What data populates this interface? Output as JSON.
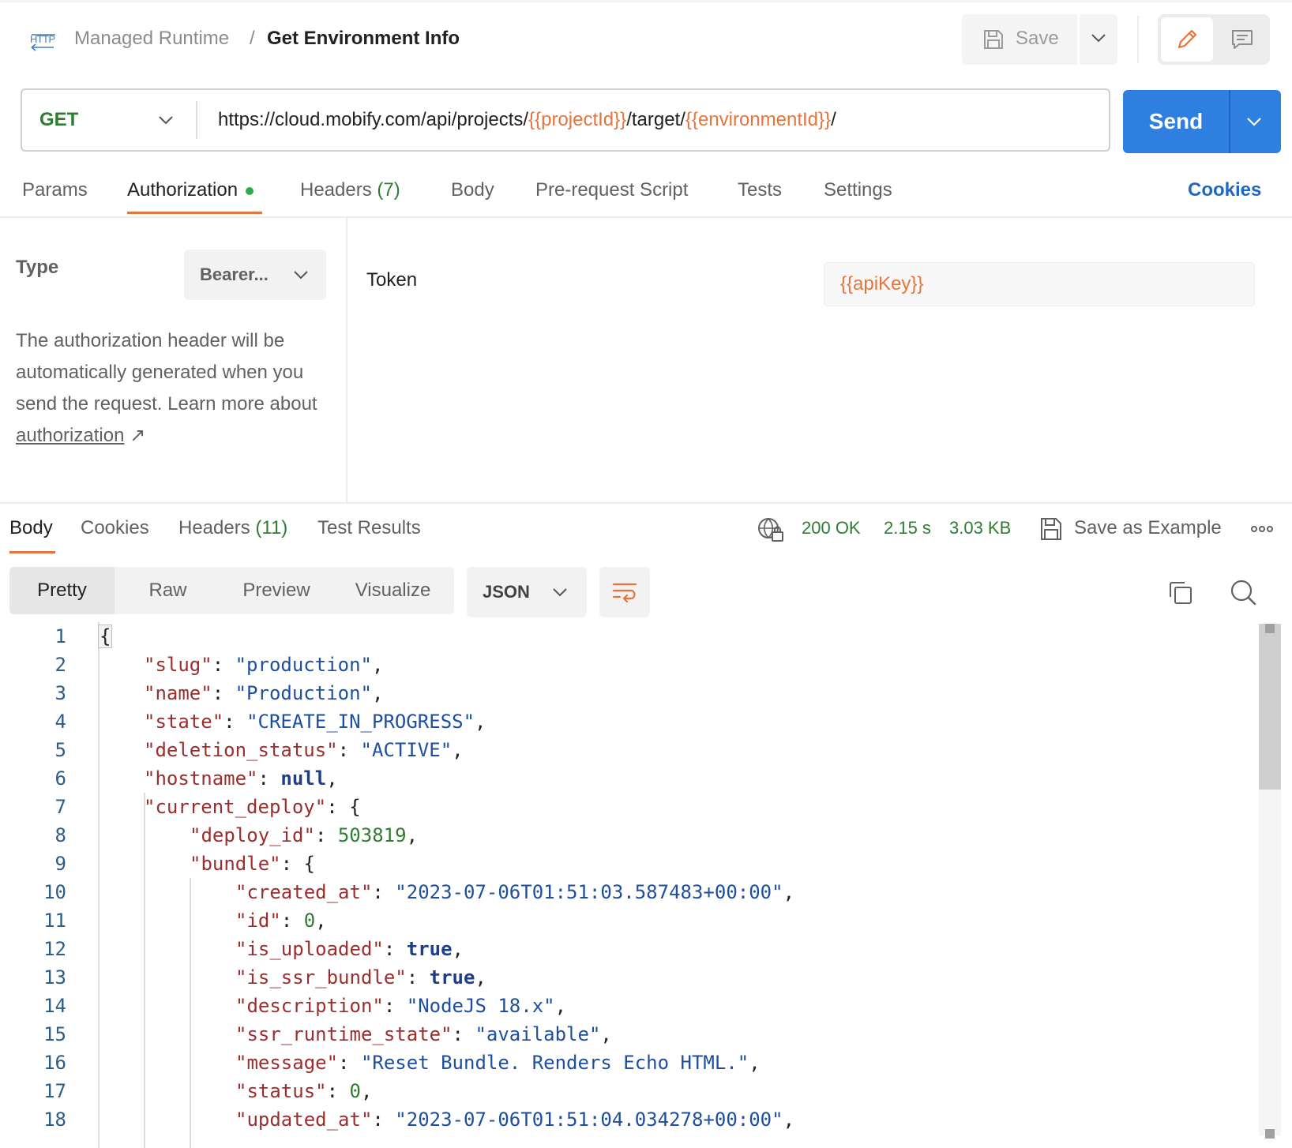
{
  "header": {
    "protocol_icon_text": "HTTP",
    "collection": "Managed Runtime",
    "separator": "/",
    "request_name": "Get Environment Info",
    "save_label": "Save"
  },
  "request": {
    "method": "GET",
    "url_parts": {
      "p1": "https://cloud.mobify.com/api/projects/",
      "v1": "{{projectId}}",
      "p2": "/target/",
      "v2": "{{environmentId}}",
      "p3": "/"
    },
    "send_label": "Send"
  },
  "request_tabs": {
    "params": "Params",
    "authorization": "Authorization",
    "headers": "Headers",
    "headers_count": "(7)",
    "body": "Body",
    "prerequest": "Pre-request Script",
    "tests": "Tests",
    "settings": "Settings",
    "cookies": "Cookies"
  },
  "auth": {
    "type_label": "Type",
    "type_value": "Bearer...",
    "help_text": "The authorization header will be automatically generated when you send the request. Learn more about",
    "help_link": "authorization",
    "help_arrow": "↗",
    "token_label": "Token",
    "token_value": "{{apiKey}}"
  },
  "response_tabs": {
    "body": "Body",
    "cookies": "Cookies",
    "headers": "Headers",
    "headers_count": "(11)",
    "test_results": "Test Results"
  },
  "response_status": {
    "status": "200 OK",
    "time": "2.15 s",
    "size": "3.03 KB",
    "save_example": "Save as Example"
  },
  "view": {
    "modes": [
      "Pretty",
      "Raw",
      "Preview",
      "Visualize"
    ],
    "active_mode": "Pretty",
    "format": "JSON"
  },
  "code": {
    "line_numbers": [
      "1",
      "2",
      "3",
      "4",
      "5",
      "6",
      "7",
      "8",
      "9",
      "10",
      "11",
      "12",
      "13",
      "14",
      "15",
      "16",
      "17",
      "18"
    ],
    "l1_open": "{",
    "l2_key": "\"slug\"",
    "l2_val": "\"production\"",
    "l3_key": "\"name\"",
    "l3_val": "\"Production\"",
    "l4_key": "\"state\"",
    "l4_val": "\"CREATE_IN_PROGRESS\"",
    "l5_key": "\"deletion_status\"",
    "l5_val": "\"ACTIVE\"",
    "l6_key": "\"hostname\"",
    "l6_val": "null",
    "l7_key": "\"current_deploy\"",
    "l7_open": "{",
    "l8_key": "\"deploy_id\"",
    "l8_val": "503819",
    "l9_key": "\"bundle\"",
    "l9_open": "{",
    "l10_key": "\"created_at\"",
    "l10_val": "\"2023-07-06T01:51:03.587483+00:00\"",
    "l11_key": "\"id\"",
    "l11_val": "0",
    "l12_key": "\"is_uploaded\"",
    "l12_val": "true",
    "l13_key": "\"is_ssr_bundle\"",
    "l13_val": "true",
    "l14_key": "\"description\"",
    "l14_val": "\"NodeJS 18.x\"",
    "l15_key": "\"ssr_runtime_state\"",
    "l15_val": "\"available\"",
    "l16_key": "\"message\"",
    "l16_val": "\"Reset Bundle. Renders Echo HTML.\"",
    "l17_key": "\"status\"",
    "l17_val": "0",
    "l18_key": "\"updated_at\"",
    "l18_val": "\"2023-07-06T01:51:04.034278+00:00\""
  },
  "colors": {
    "accent_orange": "#e8743b",
    "send_blue": "#2f7fe0",
    "success_green": "#2e7d32",
    "link_blue": "#1c67c8"
  },
  "icons": [
    "http-icon",
    "save-icon",
    "chevron-down-icon",
    "pencil-icon",
    "comment-icon",
    "globe-lock-icon",
    "more-icon",
    "wrap-lines-icon",
    "copy-icon",
    "search-icon"
  ]
}
